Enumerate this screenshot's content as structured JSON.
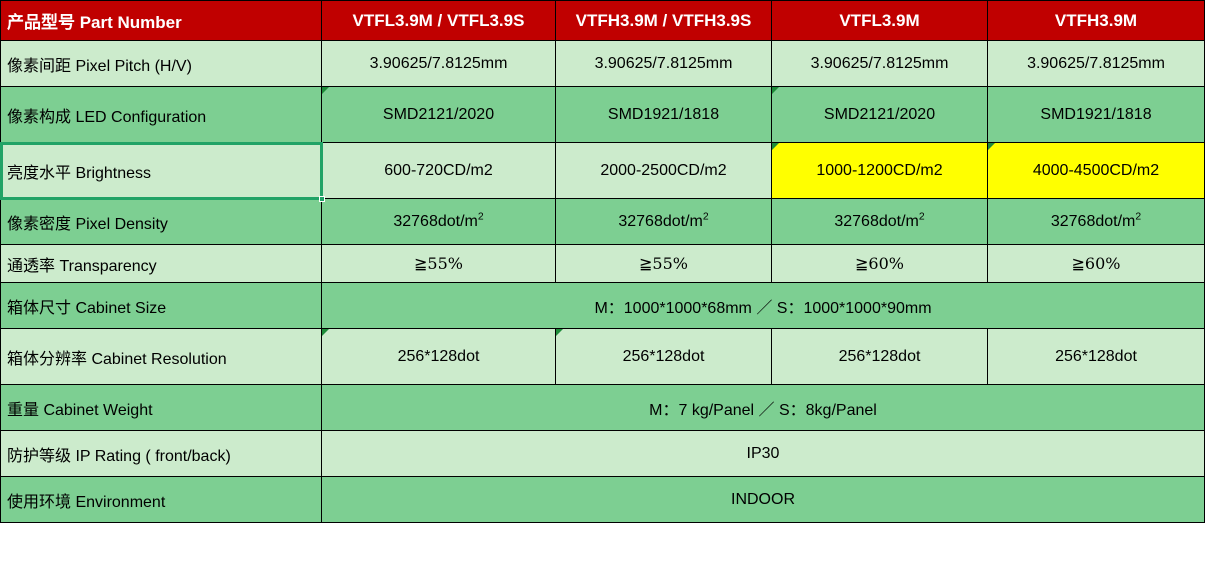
{
  "table": {
    "header": {
      "label": "产品型号 Part Number",
      "columns": [
        "VTFL3.9M / VTFL3.9S",
        "VTFH3.9M / VTFH3.9S",
        "VTFL3.9M",
        "VTFH3.9M"
      ]
    },
    "rows": [
      {
        "label": "像素间距 Pixel Pitch (H/V)",
        "values": [
          "3.90625/7.8125mm",
          "3.90625/7.8125mm",
          "3.90625/7.8125mm",
          "3.90625/7.8125mm"
        ]
      },
      {
        "label": "像素构成 LED Configuration",
        "values": [
          "SMD2121/2020",
          "SMD1921/1818",
          "SMD2121/2020",
          "SMD1921/1818"
        ]
      },
      {
        "label": "亮度水平 Brightness",
        "values": [
          "600-720CD/m2",
          "2000-2500CD/m2",
          "1000-1200CD/m2",
          "4000-4500CD/m2"
        ]
      },
      {
        "label": "像素密度 Pixel Density",
        "values": [
          "32768dot/m",
          "32768dot/m",
          "32768dot/m",
          "32768dot/m"
        ],
        "superscript": "2"
      },
      {
        "label": "通透率 Transparency",
        "values": [
          "≧55%",
          "≧55%",
          "≧60%",
          "≧60%"
        ]
      },
      {
        "label": "箱体尺寸 Cabinet Size",
        "merged_value": "M：1000*1000*68mm ／ S：1000*1000*90mm"
      },
      {
        "label": "箱体分辨率 Cabinet Resolution",
        "values": [
          "256*128dot",
          "256*128dot",
          "256*128dot",
          "256*128dot"
        ]
      },
      {
        "label": "重量  Cabinet Weight",
        "merged_value": "M：7 kg/Panel  ／  S：8kg/Panel"
      },
      {
        "label": "防护等级 IP Rating ( front/back)",
        "merged_value": "IP30"
      },
      {
        "label": "使用环境 Environment",
        "merged_value": "INDOOR"
      }
    ]
  },
  "colors": {
    "header_background": "#C00000",
    "header_text": "#FFFFFF",
    "row_light": "#CCEBCC",
    "row_dark": "#7DCF92",
    "highlight_yellow": "#FFFF00",
    "emphasis_text": "#FF0000",
    "selection_outline": "#21A366"
  }
}
